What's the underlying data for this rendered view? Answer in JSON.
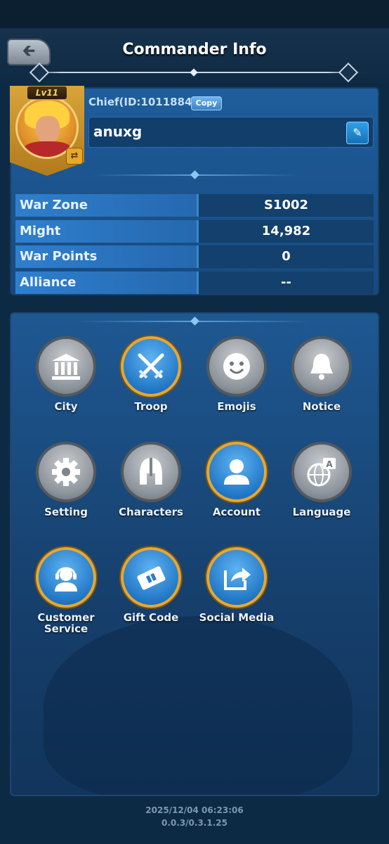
{
  "header": {
    "title": "Commander Info",
    "back_icon": "arrow-left-icon"
  },
  "profile": {
    "level": "Lv11",
    "chief_id": "Chief(ID:1011884)",
    "copy_label": "Copy",
    "name": "anuxg",
    "edit_icon": "edit-icon",
    "swap_icon": "swap-icon"
  },
  "stats": [
    {
      "label": "War Zone",
      "value": "S1002"
    },
    {
      "label": "Might",
      "value": "14,982"
    },
    {
      "label": "War Points",
      "value": "0"
    },
    {
      "label": "Alliance",
      "value": "--"
    }
  ],
  "menu": [
    {
      "label": "City",
      "icon": "city-hall-icon",
      "style": "grey"
    },
    {
      "label": "Troop",
      "icon": "crossed-swords-icon",
      "style": "gold"
    },
    {
      "label": "Emojis",
      "icon": "smiley-icon",
      "style": "grey"
    },
    {
      "label": "Notice",
      "icon": "bell-icon",
      "style": "grey"
    },
    {
      "label": "Setting",
      "icon": "gear-icon",
      "style": "grey"
    },
    {
      "label": "Characters",
      "icon": "helmet-icon",
      "style": "grey"
    },
    {
      "label": "Account",
      "icon": "user-icon",
      "style": "gold"
    },
    {
      "label": "Language",
      "icon": "globe-language-icon",
      "style": "grey"
    },
    {
      "label": "Customer Service",
      "icon": "headset-icon",
      "style": "gold"
    },
    {
      "label": "Gift Code",
      "icon": "gift-ticket-icon",
      "style": "gold"
    },
    {
      "label": "Social Media",
      "icon": "share-icon",
      "style": "gold"
    }
  ],
  "footer": {
    "timestamp": "2025/12/04 06:23:06",
    "version": "0.0.3/0.3.1.25"
  },
  "colors": {
    "background": "#0d2a44",
    "panel": "#1e5892",
    "stat_label": "#2f7fce",
    "gold_ring": "#e2a838"
  }
}
